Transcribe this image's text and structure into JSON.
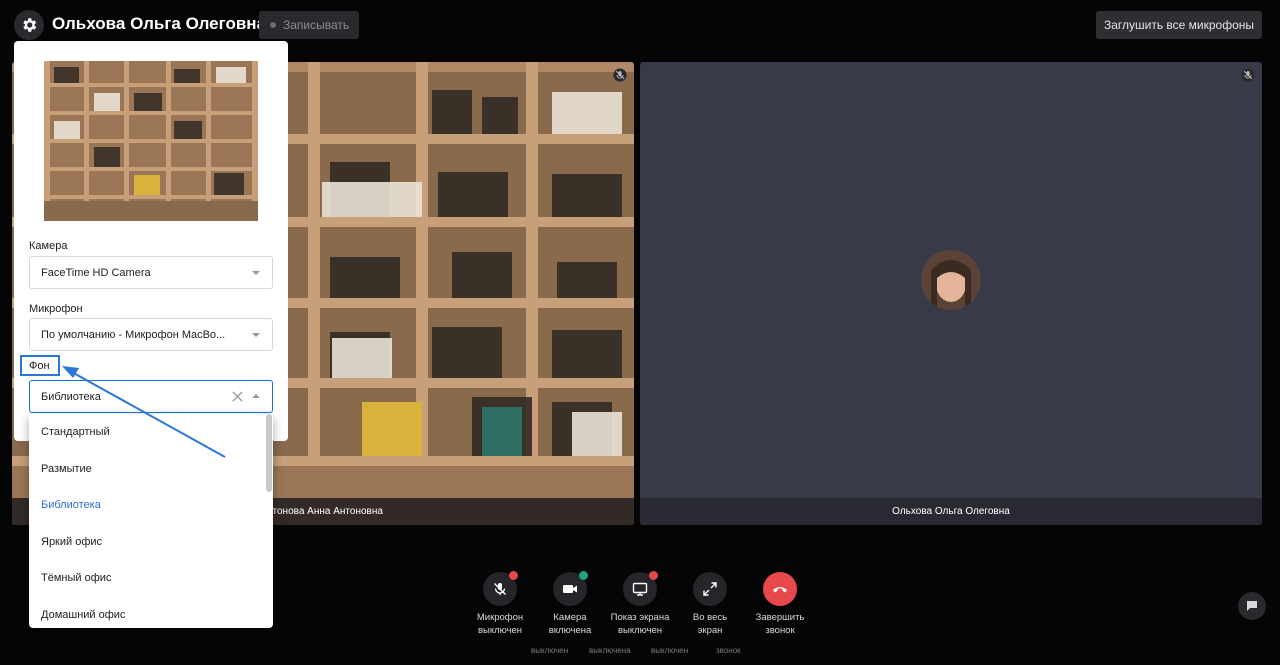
{
  "header": {
    "title": "Ольхова Ольга Олеговна",
    "record_label": "Записывать",
    "mute_all_label": "Заглушить все микрофоны"
  },
  "tiles": {
    "left_caption": "нтонова Анна Антоновна",
    "right_caption": "Ольхова Ольга Олеговна"
  },
  "settings": {
    "camera_label": "Камера",
    "camera_value": "FaceTime HD Camera",
    "mic_label": "Микрофон",
    "mic_value": "По умолчанию - Микрофон MacBo...",
    "bg_label": "Фон",
    "bg_value": "Библиотека",
    "bg_options": [
      "Стандартный",
      "Размытие",
      "Библиотека",
      "Яркий офис",
      "Тёмный офис",
      "Домашний офис"
    ],
    "bg_selected_index": 2
  },
  "controls": [
    {
      "label1": "Микрофон",
      "label2": "выключен",
      "icon": "mic-off-icon",
      "badge": "#e5484d"
    },
    {
      "label1": "Камера",
      "label2": "включена",
      "icon": "camera-icon",
      "badge": "#1fa37f"
    },
    {
      "label1": "Показ экрана",
      "label2": "выключен",
      "icon": "screen-share-icon",
      "badge": "#e5484d"
    },
    {
      "label1": "Во весь",
      "label2": "экран",
      "icon": "fullscreen-icon",
      "badge": ""
    },
    {
      "label1": "Завершить",
      "label2": "звонок",
      "icon": "hangup-icon",
      "badge": ""
    }
  ],
  "ghost_labels": [
    "выключен",
    "выключена",
    "выключен",
    "звонок"
  ],
  "colors": {
    "accent": "#2b78d6",
    "hangup": "#e5484d",
    "selected_option": "#2f6fd1"
  }
}
